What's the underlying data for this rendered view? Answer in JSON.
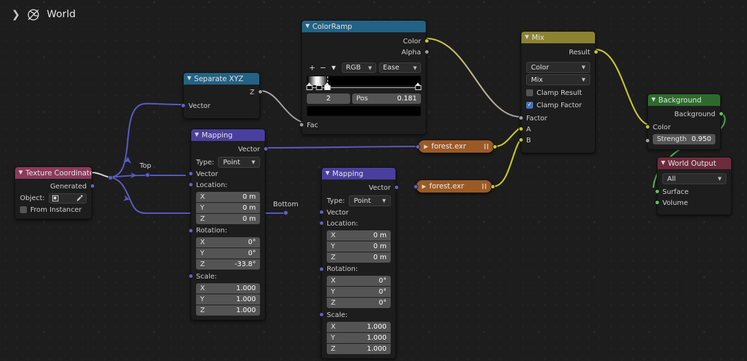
{
  "breadcrumb": {
    "expand_icon": "chevron-right-icon",
    "world_icon": "world-globe-icon",
    "label": "World"
  },
  "colors": {
    "canvas": "#1d1d1d",
    "node_body": "#1d1d1d",
    "header_input": "#8c3a5a",
    "header_converter": "#246283",
    "header_color": "#8a8332",
    "header_vector": "#4a3f9e",
    "header_shader": "#2d6b2d",
    "header_output": "#6d2b3e",
    "header_texture": "#9a5a26",
    "socket_vector": "#6363c7",
    "socket_color": "#c7c729",
    "socket_gray": "#9d9d9d",
    "socket_shader": "#62c361",
    "wire_vector": "#5a5ac4",
    "wire_color": "#c7c729",
    "wire_gray": "#b4b4b4",
    "wire_shader": "#4f9f4f",
    "checkbox_on": "#4772b3"
  },
  "nodes": {
    "texture_coordinate": {
      "title": "Texture Coordinate",
      "outputs": [
        {
          "label": "Generated",
          "type": "vector"
        }
      ],
      "object_label": "Object:",
      "object_value": "",
      "eyedropper_icon": "eyedropper-icon",
      "object_icon": "object-data-icon",
      "from_instancer_label": "From Instancer",
      "from_instancer_checked": false
    },
    "separate_xyz": {
      "title": "Separate XYZ",
      "outputs": [
        {
          "label": "Z",
          "type": "gray"
        }
      ],
      "inputs": [
        {
          "label": "Vector",
          "type": "vector"
        }
      ]
    },
    "color_ramp": {
      "title": "ColorRamp",
      "outputs": [
        {
          "label": "Color",
          "type": "color"
        },
        {
          "label": "Alpha",
          "type": "gray"
        }
      ],
      "inputs": [
        {
          "label": "Fac",
          "type": "gray"
        }
      ],
      "add_icon": "plus-icon",
      "remove_icon": "minus-icon",
      "menu_icon": "chevron-down-icon",
      "color_mode": "RGB",
      "interpolation": "Ease",
      "index_value": "2",
      "pos_label": "Pos",
      "pos_value": "0.181",
      "selected_color": "#000000",
      "stops": [
        {
          "pos": 0.0,
          "color": "#000000",
          "selected": false
        },
        {
          "pos": 0.085,
          "color": "#f5f5f5",
          "selected": false
        },
        {
          "pos": 0.181,
          "color": "#000000",
          "selected": true
        },
        {
          "pos": 1.0,
          "color": "#000000",
          "selected": false
        }
      ]
    },
    "mapping_top": {
      "title": "Mapping",
      "outputs": [
        {
          "label": "Vector",
          "type": "vector"
        }
      ],
      "type_label": "Type:",
      "type_value": "Point",
      "vector_label": "Vector",
      "location_label": "Location:",
      "location": [
        {
          "axis": "X",
          "value": "0 m"
        },
        {
          "axis": "Y",
          "value": "0 m"
        },
        {
          "axis": "Z",
          "value": "0 m"
        }
      ],
      "rotation_label": "Rotation:",
      "rotation": [
        {
          "axis": "X",
          "value": "0°"
        },
        {
          "axis": "Y",
          "value": "0°"
        },
        {
          "axis": "Z",
          "value": "-33.8°"
        }
      ],
      "scale_label": "Scale:",
      "scale": [
        {
          "axis": "X",
          "value": "1.000"
        },
        {
          "axis": "Y",
          "value": "1.000"
        },
        {
          "axis": "Z",
          "value": "1.000"
        }
      ]
    },
    "mapping_bottom": {
      "title": "Mapping",
      "outputs": [
        {
          "label": "Vector",
          "type": "vector"
        }
      ],
      "type_label": "Type:",
      "type_value": "Point",
      "vector_label": "Vector",
      "location_label": "Location:",
      "location": [
        {
          "axis": "X",
          "value": "0 m"
        },
        {
          "axis": "Y",
          "value": "0 m"
        },
        {
          "axis": "Z",
          "value": "0 m"
        }
      ],
      "rotation_label": "Rotation:",
      "rotation": [
        {
          "axis": "X",
          "value": "0°"
        },
        {
          "axis": "Y",
          "value": "0°"
        },
        {
          "axis": "Z",
          "value": "0°"
        }
      ],
      "scale_label": "Scale:",
      "scale": [
        {
          "axis": "X",
          "value": "1.000"
        },
        {
          "axis": "Y",
          "value": "1.000"
        },
        {
          "axis": "Z",
          "value": "1.000"
        }
      ]
    },
    "env_top": {
      "title": "forest.exr"
    },
    "env_bottom": {
      "title": "forest.exr"
    },
    "mix": {
      "title": "Mix",
      "outputs": [
        {
          "label": "Result",
          "type": "color"
        }
      ],
      "data_type": "Color",
      "blend_mode": "Mix",
      "clamp_result_label": "Clamp Result",
      "clamp_result_checked": false,
      "clamp_factor_label": "Clamp Factor",
      "clamp_factor_checked": true,
      "inputs": [
        {
          "label": "Factor",
          "type": "gray"
        },
        {
          "label": "A",
          "type": "color"
        },
        {
          "label": "B",
          "type": "color"
        }
      ]
    },
    "background": {
      "title": "Background",
      "outputs": [
        {
          "label": "Background",
          "type": "shader"
        }
      ],
      "inputs": [
        {
          "label": "Color",
          "type": "color"
        }
      ],
      "strength_label": "Strength",
      "strength_value": "0.950"
    },
    "world_output": {
      "title": "World Output",
      "target": "All",
      "inputs": [
        {
          "label": "Surface",
          "type": "shader"
        },
        {
          "label": "Volume",
          "type": "shader"
        }
      ]
    }
  },
  "reroutes": [
    {
      "name": "hub",
      "label": ""
    },
    {
      "name": "top",
      "label": "Top"
    },
    {
      "name": "bottom",
      "label": "Bottom"
    }
  ]
}
